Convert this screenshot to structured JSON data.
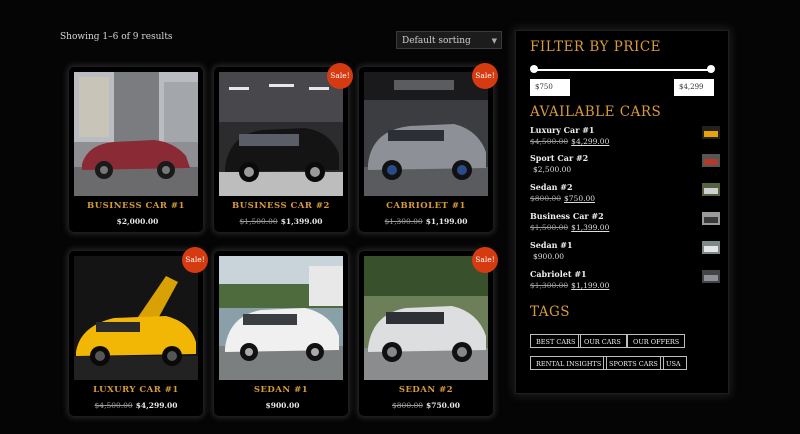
{
  "toolbar": {
    "results_text": "Showing 1–6 of 9 results",
    "sorting_value": "Default sorting"
  },
  "products": [
    {
      "name": "BUSINESS CAR #1",
      "old_price": "",
      "price": "$2,000.00",
      "sale": false,
      "badge": "",
      "car_color": "#8a2a34",
      "scene": "street"
    },
    {
      "name": "BUSINESS CAR #2",
      "old_price": "$1,500.00",
      "price": "$1,399.00",
      "sale": true,
      "badge": "Sale!",
      "car_color": "#141414",
      "scene": "showroom"
    },
    {
      "name": "CABRIOLET #1",
      "old_price": "$1,300.00",
      "price": "$1,199.00",
      "sale": true,
      "badge": "Sale!",
      "car_color": "#8d9096",
      "scene": "garage"
    },
    {
      "name": "LUXURY CAR #1",
      "old_price": "$4,500.00",
      "price": "$4,299.00",
      "sale": true,
      "badge": "Sale!",
      "car_color": "#f2b705",
      "scene": "dark"
    },
    {
      "name": "SEDAN #1",
      "old_price": "",
      "price": "$900.00",
      "sale": false,
      "badge": "",
      "car_color": "#f0f0f0",
      "scene": "outdoor"
    },
    {
      "name": "SEDAN #2",
      "old_price": "$800.00",
      "price": "$750.00",
      "sale": true,
      "badge": "Sale!",
      "car_color": "#dcdedf",
      "scene": "outdoor2"
    }
  ],
  "filter": {
    "title": "FILTER BY PRICE",
    "min_value": "$750",
    "max_value": "$4,299"
  },
  "available": {
    "title": "AVAILABLE CARS",
    "items": [
      {
        "name": "Luxury Car #1",
        "old_price": "$4,500.00",
        "price": "$4,299.00",
        "thumb_color": "#e8a10a"
      },
      {
        "name": "Sport Car #2",
        "old_price": "",
        "price": "$2,500.00",
        "thumb_color": "#b23a2a"
      },
      {
        "name": "Sedan #2",
        "old_price": "$800.00",
        "price": "$750.00",
        "thumb_color": "#cfd2d4"
      },
      {
        "name": "Business Car #2",
        "old_price": "$1,500.00",
        "price": "$1,399.00",
        "thumb_color": "#3a3a3a"
      },
      {
        "name": "Sedan #1",
        "old_price": "",
        "price": "$900.00",
        "thumb_color": "#e6e6e6"
      },
      {
        "name": "Cabriolet #1",
        "old_price": "$1,300.00",
        "price": "$1,199.00",
        "thumb_color": "#8d9096"
      }
    ]
  },
  "tags": {
    "title": "TAGS",
    "items": [
      "BEST CARS",
      "OUR CARS",
      "OUR OFFERS",
      "RENTAL INSIGHTS",
      "SPORTS CARS",
      "USA"
    ]
  },
  "colors": {
    "accent": "#d89a3c",
    "sale_badge": "#d63a10",
    "background": "#050505"
  }
}
